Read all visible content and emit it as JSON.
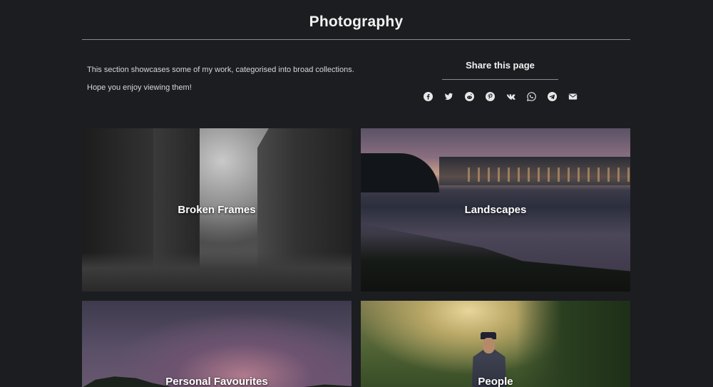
{
  "page": {
    "title": "Photography"
  },
  "intro": {
    "line1": "This section showcases some of my work, categorised into broad collections.",
    "line2": "Hope you enjoy viewing them!"
  },
  "share": {
    "title": "Share this page",
    "icons": [
      "facebook-icon",
      "twitter-icon",
      "reddit-icon",
      "pinterest-icon",
      "vk-icon",
      "whatsapp-icon",
      "telegram-icon",
      "email-icon"
    ]
  },
  "collections": [
    {
      "label": "Broken Frames"
    },
    {
      "label": "Landscapes"
    },
    {
      "label": "Personal Favourites"
    },
    {
      "label": "People"
    }
  ],
  "colors": {
    "background": "#1c1d20",
    "text": "#e8e8e8",
    "divider": "#8a8b8d"
  }
}
